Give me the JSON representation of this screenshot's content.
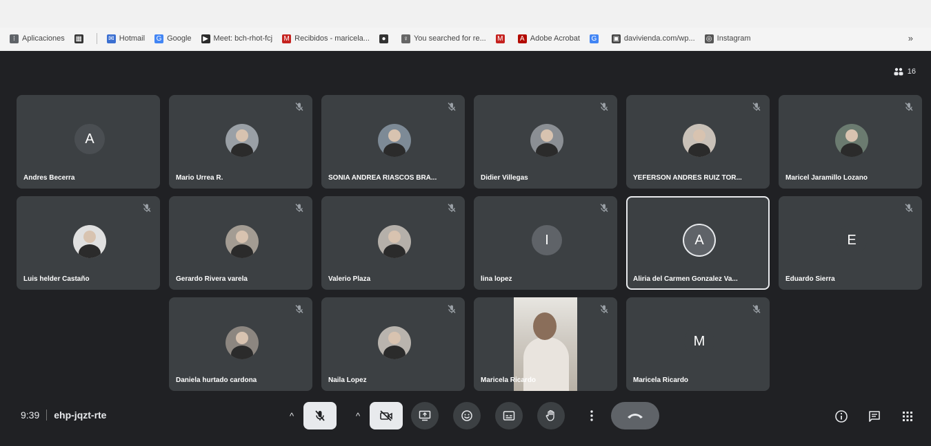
{
  "bookmarks": {
    "items": [
      {
        "label": "Aplicaciones",
        "icon": "apps-grid-icon",
        "color": "#5f6368"
      },
      {
        "label": "",
        "icon": "grid-app-icon",
        "color": "#333333"
      },
      {
        "label": "Hotmail",
        "icon": "hotmail-icon",
        "color": "#3b6fd1"
      },
      {
        "label": "Google",
        "icon": "google-icon",
        "color": "#4285f4"
      },
      {
        "label": "Meet: bch-rhot-fcj",
        "icon": "meet-icon",
        "color": "#2b2b2b"
      },
      {
        "label": "Recibidos - maricela...",
        "icon": "gmail-icon",
        "color": "#c5221f"
      },
      {
        "label": "",
        "icon": "globe-icon",
        "color": "#333333"
      },
      {
        "label": "You searched for re...",
        "icon": "microphone-icon",
        "color": "#666666"
      },
      {
        "label": "",
        "icon": "gmail-icon",
        "color": "#c5221f"
      },
      {
        "label": "Adobe Acrobat",
        "icon": "acrobat-icon",
        "color": "#b30b00"
      },
      {
        "label": "",
        "icon": "google-icon",
        "color": "#4285f4"
      },
      {
        "label": "davivienda.com/wp...",
        "icon": "site-icon",
        "color": "#444444"
      },
      {
        "label": "Instagram",
        "icon": "instagram-icon",
        "color": "#555555"
      }
    ],
    "more": "»"
  },
  "participant_count": "16",
  "tiles": [
    {
      "name": "Andres Becerra",
      "avatar": "A",
      "type": "initial",
      "color": "#4a4e52",
      "muted": false
    },
    {
      "name": "Mario Urrea R.",
      "type": "photo",
      "color": "#9aa0a6",
      "muted": true
    },
    {
      "name": "SONIA ANDREA RIASCOS BRA...",
      "type": "photo",
      "color": "#7d8a96",
      "muted": true
    },
    {
      "name": "Didier Villegas",
      "type": "photo",
      "color": "#8b8f94",
      "muted": true
    },
    {
      "name": "YEFERSON ANDRES RUIZ TOR...",
      "type": "photo",
      "color": "#c9c1b8",
      "muted": true
    },
    {
      "name": "Maricel Jaramillo Lozano",
      "type": "photo",
      "color": "#6b7b70",
      "muted": true
    },
    {
      "name": "Luis helder Castaño",
      "type": "photo",
      "color": "#e0e0e0",
      "muted": true
    },
    {
      "name": "Gerardo Rivera varela",
      "type": "photo",
      "color": "#a39c93",
      "muted": true
    },
    {
      "name": "Valerio Plaza",
      "type": "photo",
      "color": "#b5b0aa",
      "muted": true
    },
    {
      "name": "lina lopez",
      "avatar": "I",
      "type": "initial",
      "color": "#5f6368",
      "muted": true
    },
    {
      "name": "Aliria del Carmen Gonzalez Va...",
      "avatar": "A",
      "type": "initial",
      "color": "#5f6368",
      "muted": false,
      "speaking": true
    },
    {
      "name": "Eduardo Sierra",
      "avatar": "E",
      "type": "initial",
      "color": "#3c4043",
      "muted": true
    },
    {
      "name": "Daniela hurtado cardona",
      "type": "photo",
      "color": "#8c8680",
      "muted": true
    },
    {
      "name": "Naila Lopez",
      "type": "photo",
      "color": "#b9b4ae",
      "muted": true
    },
    {
      "name": "Maricela Ricardo",
      "type": "video",
      "muted": true
    },
    {
      "name": "Maricela Ricardo",
      "avatar": "M",
      "type": "initial",
      "color": "#3c4043",
      "muted": true
    }
  ],
  "meeting": {
    "time": "9:39",
    "code": "ehp-jqzt-rte"
  },
  "toolbar": {
    "mic_more": "^",
    "camera_more": "^"
  }
}
